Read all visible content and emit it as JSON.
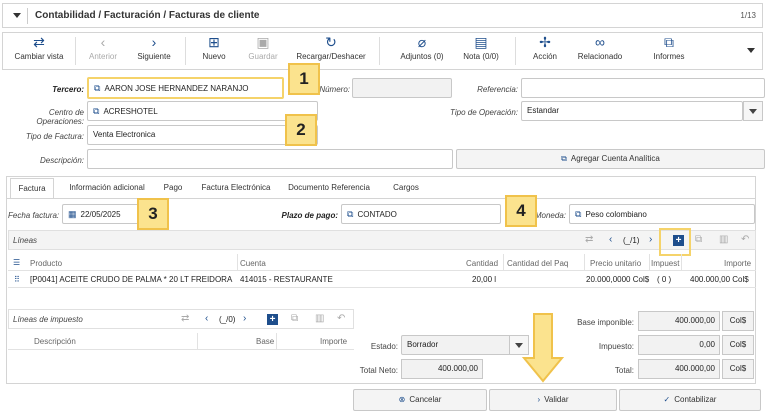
{
  "header": {
    "title": "Contabilidad / Facturación / Facturas de cliente",
    "record_count": "1/13"
  },
  "toolbar": {
    "cambiar_vista": "Cambiar vista",
    "anterior": "Anterior",
    "siguiente": "Siguiente",
    "nuevo": "Nuevo",
    "guardar": "Guardar",
    "recargar": "Recargar/Deshacer",
    "adjuntos": "Adjuntos (0)",
    "nota": "Nota (0/0)",
    "accion": "Acción",
    "relacionado": "Relacionado",
    "informes": "Informes"
  },
  "form": {
    "tercero_label": "Tercero:",
    "tercero_value": "AARON JOSE HERNANDEZ NARANJO",
    "numero_label": "Número:",
    "numero_value": "",
    "referencia_label": "Referencia:",
    "referencia_value": "",
    "centro_label": "Centro de Operaciones:",
    "centro_value": "ACRESHOTEL",
    "tipo_operacion_label": "Tipo de Operación:",
    "tipo_operacion_value": "Estandar",
    "tipo_factura_label": "Tipo de Factura:",
    "tipo_factura_value": "Venta Electronica",
    "descripcion_label": "Descripción:",
    "descripcion_value": "",
    "agregar_cuenta": "Agregar Cuenta Analítica"
  },
  "callouts": [
    "1",
    "2",
    "3",
    "4"
  ],
  "tabs": [
    "Factura",
    "Información adicional",
    "Pago",
    "Factura Electrónica",
    "Documento Referencia",
    "Cargos"
  ],
  "invoice": {
    "fecha_label": "Fecha factura:",
    "fecha_value": "22/05/2025",
    "plazo_label": "Plazo de pago:",
    "plazo_value": "CONTADO",
    "moneda_label": "Moneda:",
    "moneda_value": "Peso colombiano"
  },
  "lines": {
    "title": "Líneas",
    "pager": "(_/1)",
    "columns": [
      "Producto",
      "Cuenta",
      "Cantidad",
      "Cantidad del Paq",
      "Precio unitario",
      "Impuest",
      "Importe"
    ],
    "rows": [
      {
        "producto": "[P0041] ACEITE CRUDO DE PALMA * 20 LT FREIDORA",
        "cuenta": "414015 - RESTAURANTE",
        "cantidad": "20,00 l",
        "precio": "20.000,0000 Col$",
        "impuesto": "( 0 )",
        "importe": "400.000,00 Col$"
      }
    ]
  },
  "tax_lines": {
    "title": "Líneas de impuesto",
    "pager": "(_/0)",
    "columns": [
      "Descripción",
      "Base",
      "Importe"
    ]
  },
  "totals": {
    "estado_label": "Estado:",
    "estado_value": "Borrador",
    "total_neto_label": "Total Neto:",
    "total_neto_value": "400.000,00",
    "base_label": "Base imponible:",
    "base_value": "400.000,00",
    "impuesto_label": "Impuesto:",
    "impuesto_value": "0,00",
    "total_label": "Total:",
    "total_value": "400.000,00",
    "currency": "Col$"
  },
  "actions": {
    "cancelar": "Cancelar",
    "validar": "Validar",
    "contabilizar": "Contabilizar"
  },
  "colors": {
    "accent": "#1e4e8c",
    "callout": "#fbe38e",
    "callout_border": "#f0c24b"
  }
}
